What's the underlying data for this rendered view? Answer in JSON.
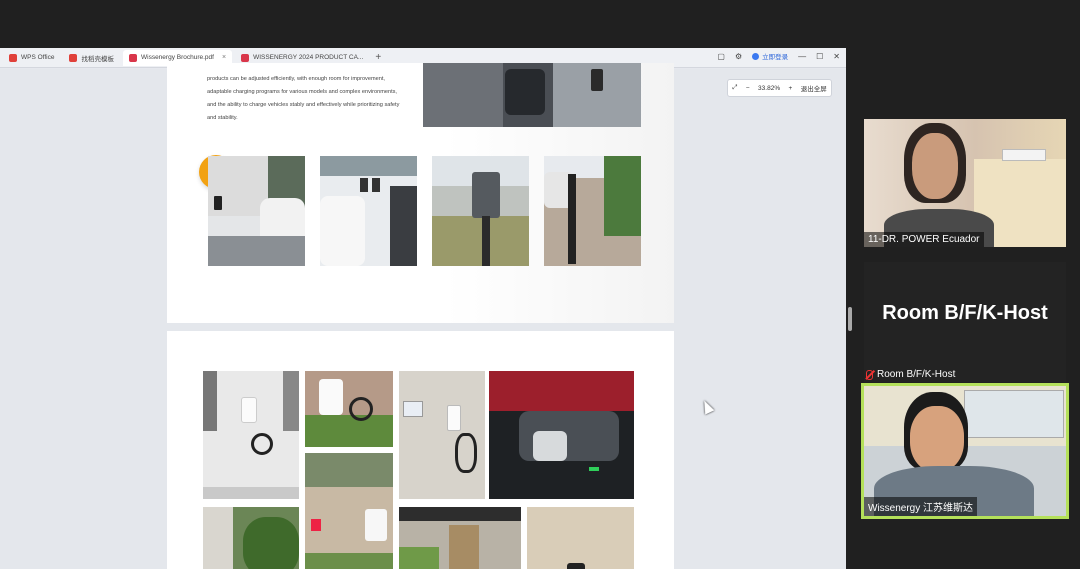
{
  "wps": {
    "tabs": [
      {
        "label": "WPS Office",
        "color": "#e0403a",
        "active": false
      },
      {
        "label": "找稻壳模板",
        "color": "#e0403a",
        "active": false
      },
      {
        "label": "Wissenergy Brochure.pdf",
        "color": "#d9364a",
        "active": true
      },
      {
        "label": "WISSENERGY 2024 PRODUCT CA...",
        "color": "#d9364a",
        "active": false
      }
    ],
    "login_label": "立即登录",
    "zoom": {
      "minus": "−",
      "value": "33.82%",
      "plus": "+",
      "exit_label": "退出全屏"
    }
  },
  "page1": {
    "paragraph": "products can be adjusted efficiently, with enough room for improvement, adaptable charging programs for various models and complex environments, and the ability to charge vehicles stably and effectively while prioritizing safety and stability.",
    "arrow": "›"
  },
  "participants": [
    {
      "name": "11-DR. POWER Ecuador"
    },
    {
      "display": "Room B/F/K-Host",
      "name": "Room B/F/K-Host"
    },
    {
      "name": "Wissenergy 江苏维斯达"
    }
  ],
  "colors": {
    "accent_orange": "#f2a213",
    "active_speaker": "#b4e05a"
  }
}
